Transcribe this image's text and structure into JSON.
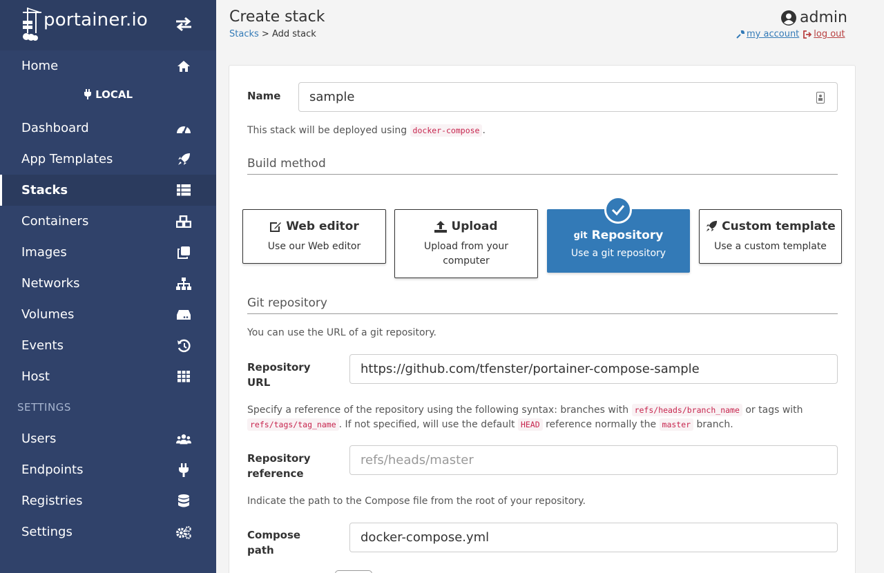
{
  "brand": {
    "logo_text": "portainer.io"
  },
  "sidebar": {
    "home_label": "Home",
    "endpoint_label": "LOCAL",
    "items": [
      {
        "label": "Dashboard",
        "icon": "tachometer-icon"
      },
      {
        "label": "App Templates",
        "icon": "rocket-icon"
      },
      {
        "label": "Stacks",
        "icon": "th-list-icon",
        "active": true
      },
      {
        "label": "Containers",
        "icon": "cubes-icon"
      },
      {
        "label": "Images",
        "icon": "clone-icon"
      },
      {
        "label": "Networks",
        "icon": "sitemap-icon"
      },
      {
        "label": "Volumes",
        "icon": "hdd-icon"
      },
      {
        "label": "Events",
        "icon": "history-icon"
      },
      {
        "label": "Host",
        "icon": "th-icon"
      }
    ],
    "settings_title": "SETTINGS",
    "settings_items": [
      {
        "label": "Users",
        "icon": "users-icon"
      },
      {
        "label": "Endpoints",
        "icon": "plug-icon"
      },
      {
        "label": "Registries",
        "icon": "database-icon"
      },
      {
        "label": "Settings",
        "icon": "cogs-icon"
      }
    ]
  },
  "header": {
    "title": "Create stack",
    "breadcrumb_link": "Stacks",
    "breadcrumb_current": "Add stack",
    "user": "admin",
    "my_account": "my account",
    "log_out": "log out"
  },
  "form": {
    "name_label": "Name",
    "name_value": "sample",
    "deploy_note_prefix": "This stack will be deployed using",
    "deploy_note_code": "docker-compose",
    "deploy_note_suffix": ".",
    "build_method_title": "Build method",
    "build_methods": [
      {
        "title": "Web editor",
        "desc": "Use our Web editor",
        "icon": "edit-icon"
      },
      {
        "title": "Upload",
        "desc": "Upload from your computer",
        "icon": "upload-icon"
      },
      {
        "title": "Repository",
        "desc": "Use a git repository",
        "icon": "git-icon",
        "icon_text": "git",
        "selected": true
      },
      {
        "title": "Custom template",
        "desc": "Use a custom template",
        "icon": "rocket-icon"
      }
    ],
    "git_title": "Git repository",
    "git_help": "You can use the URL of a git repository.",
    "repo_url_label": "Repository URL",
    "repo_url_value": "https://github.com/tfenster/portainer-compose-sample",
    "ref_help_1": "Specify a reference of the repository using the following syntax: branches with",
    "ref_help_code_1": "refs/heads/branch_name",
    "ref_help_2": "or tags with",
    "ref_help_code_2": "refs/tags/tag_name",
    "ref_help_3": ". If not specified, will use the default",
    "ref_help_code_3": "HEAD",
    "ref_help_4": "reference normally the",
    "ref_help_code_4": "master",
    "ref_help_5": "branch.",
    "repo_ref_label": "Repository reference",
    "repo_ref_placeholder": "refs/heads/master",
    "compose_help": "Indicate the path to the Compose file from the root of your repository.",
    "compose_label": "Compose path",
    "compose_value": "docker-compose.yml"
  },
  "colors": {
    "sidebar": "#30426a",
    "accent": "#337ab7",
    "code": "#c7254e"
  }
}
